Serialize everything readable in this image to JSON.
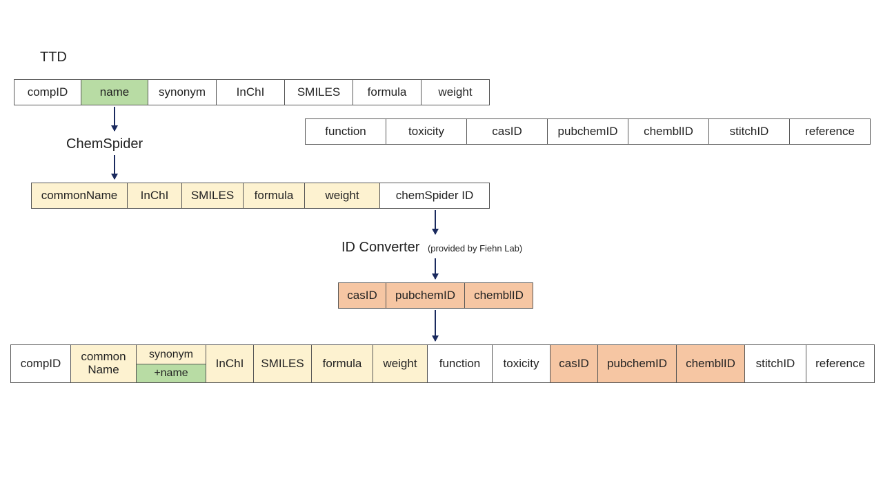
{
  "labels": {
    "ttd": "TTD",
    "chemspider": "ChemSpider",
    "idconv": "ID Converter",
    "idconv_note": "(provided by Fiehn Lab)"
  },
  "row1": [
    "compID",
    "name",
    "synonym",
    "InChI",
    "SMILES",
    "formula",
    "weight"
  ],
  "row2": [
    "function",
    "toxicity",
    "casID",
    "pubchemID",
    "chemblID",
    "stitchID",
    "reference"
  ],
  "row3": [
    "commonName",
    "InChI",
    "SMILES",
    "formula",
    "weight",
    "chemSpider ID"
  ],
  "row4": [
    "casID",
    "pubchemID",
    "chemblID"
  ],
  "row5": {
    "c0": "compID",
    "c1": "common\nName",
    "c2a": "synonym",
    "c2b": "+name",
    "c3": "InChI",
    "c4": "SMILES",
    "c5": "formula",
    "c6": "weight",
    "c7": "function",
    "c8": "toxicity",
    "c9": "casID",
    "c10": "pubchemID",
    "c11": "chemblID",
    "c12": "stitchID",
    "c13": "reference"
  }
}
